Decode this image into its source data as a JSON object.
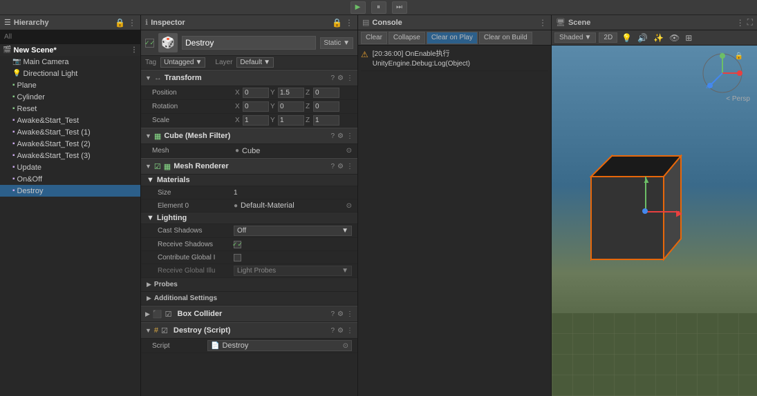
{
  "topbar": {
    "play_label": "▶",
    "pause_label": "⏸",
    "step_label": "⏭"
  },
  "hierarchy": {
    "title": "Hierarchy",
    "search_placeholder": "All",
    "items": [
      {
        "name": "New Scene*",
        "icon": "🎬",
        "type": "scene",
        "selected": false
      },
      {
        "name": "Main Camera",
        "icon": "📷",
        "type": "camera",
        "indented": true
      },
      {
        "name": "Directional Light",
        "icon": "💡",
        "type": "light",
        "indented": true
      },
      {
        "name": "Plane",
        "icon": "▪",
        "type": "mesh",
        "indented": true
      },
      {
        "name": "Cylinder",
        "icon": "▪",
        "type": "mesh",
        "indented": true
      },
      {
        "name": "Reset",
        "icon": "▪",
        "type": "mesh",
        "indented": true
      },
      {
        "name": "Awake&Start_Test",
        "icon": "▪",
        "type": "script",
        "indented": true
      },
      {
        "name": "Awake&Start_Test (1)",
        "icon": "▪",
        "type": "script",
        "indented": true
      },
      {
        "name": "Awake&Start_Test (2)",
        "icon": "▪",
        "type": "script",
        "indented": true
      },
      {
        "name": "Awake&Start_Test (3)",
        "icon": "▪",
        "type": "script",
        "indented": true
      },
      {
        "name": "Update",
        "icon": "▪",
        "type": "script",
        "indented": true
      },
      {
        "name": "On&Off",
        "icon": "▪",
        "type": "script",
        "indented": true
      },
      {
        "name": "Destroy",
        "icon": "▪",
        "type": "script",
        "indented": true,
        "selected": true
      }
    ]
  },
  "inspector": {
    "title": "Inspector",
    "object_name": "Destroy",
    "static_label": "Static ▼",
    "tag_label": "Tag",
    "tag_value": "Untagged",
    "layer_label": "Layer",
    "layer_value": "Default",
    "transform": {
      "title": "Transform",
      "position_label": "Position",
      "pos_x": "0",
      "pos_y": "1.5",
      "pos_z": "0",
      "rotation_label": "Rotation",
      "rot_x": "0",
      "rot_y": "0",
      "rot_z": "0",
      "scale_label": "Scale",
      "scale_x": "1",
      "scale_y": "1",
      "scale_z": "1"
    },
    "mesh_filter": {
      "title": "Cube (Mesh Filter)",
      "mesh_label": "Mesh",
      "mesh_value": "Cube"
    },
    "mesh_renderer": {
      "title": "Mesh Renderer",
      "materials_label": "Materials",
      "size_label": "Size",
      "size_value": "1",
      "element0_label": "Element 0",
      "element0_value": "Default-Material",
      "lighting_label": "Lighting",
      "cast_shadows_label": "Cast Shadows",
      "cast_shadows_value": "Off",
      "receive_shadows_label": "Receive Shadows",
      "receive_shadows_checked": true,
      "contribute_global_label": "Contribute Global I",
      "contribute_global_checked": false,
      "receive_global_label": "Receive Global Illu",
      "receive_global_value": "Light Probes"
    },
    "probes": {
      "title": "Probes"
    },
    "additional_settings": {
      "title": "Additional Settings"
    },
    "box_collider": {
      "title": "Box Collider"
    },
    "destroy_script": {
      "title": "Destroy (Script)",
      "script_label": "Script",
      "script_value": "Destroy"
    }
  },
  "console": {
    "title": "Console",
    "clear_label": "Clear",
    "collapse_label": "Collapse",
    "clear_on_play_label": "Clear on Play",
    "clear_on_build_label": "Clear on Build",
    "message": "[20:36:00] OnEnable执行",
    "message2": "UnityEngine.Debug:Log(Object)"
  },
  "scene": {
    "title": "Scene",
    "shaded_label": "Shaded",
    "label_2d": "2D",
    "persp_label": "< Persp"
  }
}
